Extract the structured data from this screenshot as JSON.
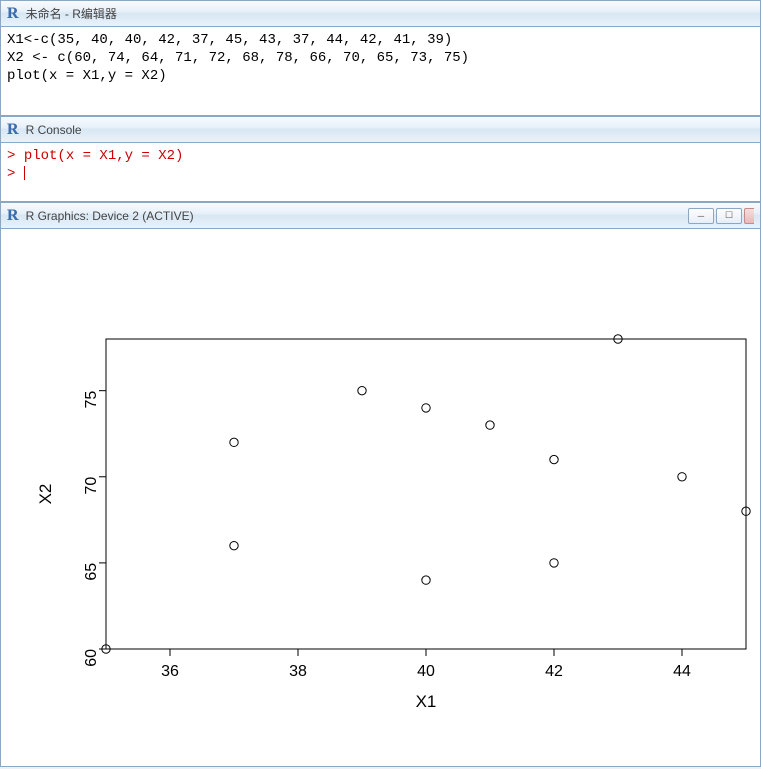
{
  "editor": {
    "title": "未命名 - R编辑器",
    "lines": [
      "X1<-c(35, 40, 40, 42, 37, 45, 43, 37, 44, 42, 41, 39)",
      "X2 <- c(60, 74, 64, 71, 72, 68, 78, 66, 70, 65, 73, 75)",
      "plot(x = X1,y = X2)"
    ]
  },
  "console": {
    "title": "R Console",
    "lines": [
      {
        "prompt": "> ",
        "cmd": "plot(x = X1,y = X2)"
      },
      {
        "prompt": "> ",
        "cmd": ""
      }
    ]
  },
  "graphics": {
    "title": "R Graphics: Device 2 (ACTIVE)"
  },
  "chart_data": {
    "type": "scatter",
    "title": "",
    "xlabel": "X1",
    "ylabel": "X2",
    "xlim": [
      35,
      45
    ],
    "ylim": [
      60,
      78
    ],
    "x_ticks": [
      36,
      38,
      40,
      42,
      44
    ],
    "y_ticks": [
      60,
      65,
      70,
      75
    ],
    "x": [
      35,
      40,
      40,
      42,
      37,
      45,
      43,
      37,
      44,
      42,
      41,
      39
    ],
    "y": [
      60,
      74,
      64,
      71,
      72,
      68,
      78,
      66,
      70,
      65,
      73,
      75
    ]
  }
}
